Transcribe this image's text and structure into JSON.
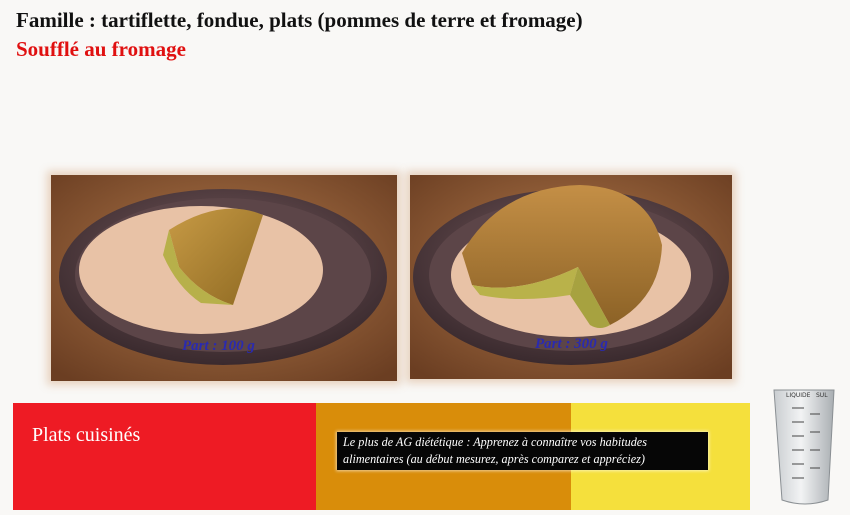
{
  "header": {
    "family_title": "Famille : tartiflette, fondue, plats (pommes de terre et fromage)",
    "dish_title": "Soufflé au fromage"
  },
  "portions": [
    {
      "label": "Part : 100 g",
      "grams": 100
    },
    {
      "label": "Part : 300 g",
      "grams": 300
    }
  ],
  "footer": {
    "category": "Plats cuisinés",
    "tip_line1": "Le plus de AG diététique : Apprenez à connaître vos habitudes",
    "tip_line2": "alimentaires (au début mesurez, après comparez et appréciez)",
    "cup_labels": {
      "liquid": "LIQUIDE",
      "solid": "SUL"
    }
  },
  "colors": {
    "dish_title": "#e01010",
    "band_red": "#ee1b24",
    "band_orange": "#d98d0a",
    "band_yellow": "#f5e03c",
    "portion_label": "#2a2ab0"
  }
}
